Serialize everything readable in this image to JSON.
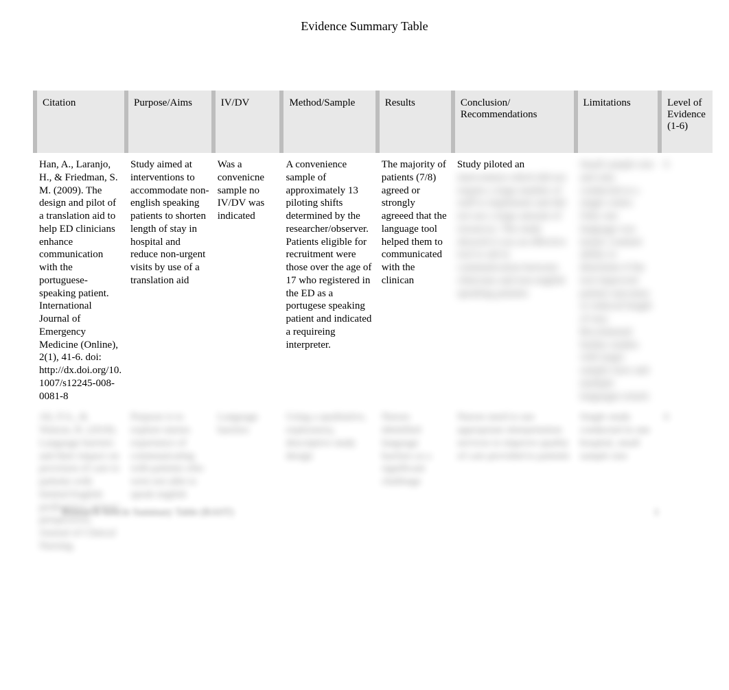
{
  "title": "Evidence Summary Table",
  "headers": {
    "citation": "Citation",
    "purpose": "Purpose/Aims",
    "ivdv": "IV/DV",
    "method": "Method/Sample",
    "results": "Results",
    "conclusion": "Conclusion/ Recommendations",
    "limitations": "Limitations",
    "level": "Level of Evidence (1-6)"
  },
  "rows": [
    {
      "citation": "Han, A., Laranjo, H., & Friedman, S. M. (2009). The design and pilot of a translation aid to help ED clinicians enhance communication with the portuguese-speaking patient. International Journal of Emergency Medicine (Online), 2(1), 41-6. doi: http://dx.doi.org/10.1007/s12245-008-0081-8",
      "purpose": "Study aimed at interventions to accommodate non-english speaking patients  to shorten length of stay in hospital and reduce non-urgent visits by use of a translation aid",
      "ivdv": "Was a convenicne sample no IV/DV was indicated",
      "method": "A convenience sample of approximately 13 piloting shifts determined by the researcher/observer. Patients eligible for recruitment were those over the age of 17 who registered in the ED as a portugese speaking patient and indicated a requireing interpreter.",
      "results": "The majority of patients (7/8) agreed or strongly agreeed that the language tool helped them to communicated with the clinican",
      "conclusion_clear": "Study piloted an",
      "conclusion_blur": "intervention which did not require a large number of staff to implement and did not use a large amount of resources. The study showed it was an effective tool to aid in communication between clinicians and non-english speaking patients",
      "limitations_blur": "Small sample size and only conducted at a single centre. Only one language was tested. Limited ability to determine if the tool improved patient outcomes or reduced length of stay. Recommend further studies with larger sample sizes and multiple languages tested.",
      "level_blur": "6"
    },
    {
      "citation_blur": "Ali, P.A., & Watson, R. (2018). Language barriers and their impact on provision of care to patients with limited English proficiency: nurses' perspectives. Journal of Clinical Nursing.",
      "purpose_blur": "Purpose is to explore nurses experience of communicating with patients who were not able to speak english",
      "ivdv_blur": "Language barriers",
      "method_blur": "Using a qualitative, exploratory, descriptive study design",
      "results_blur": "Nurses identified language barriers as a significant challenge",
      "conclusion_blur": "Nurses need to use appropriate interpretation services to improve quality of care provided to patients",
      "limitations_blur": "Single study conducted in one hospital, small sample size",
      "level_blur": "6"
    }
  ],
  "footer": {
    "left": "Research Article Summary Table (RAST)",
    "right": "1"
  }
}
